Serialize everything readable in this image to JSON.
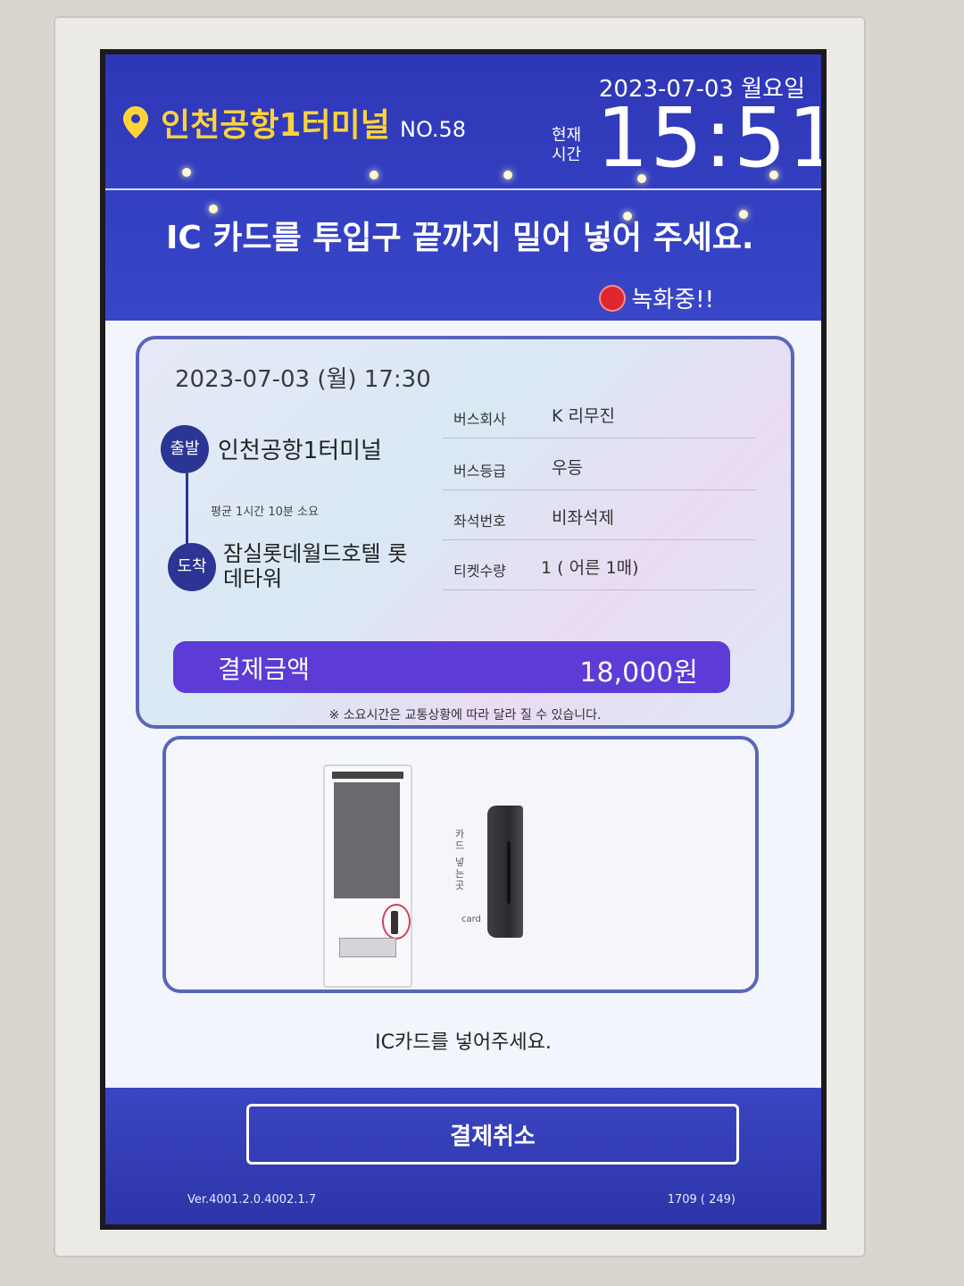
{
  "header": {
    "terminal": "인천공항1터미널",
    "kiosk_no": "NO.58",
    "date": "2023-07-03 월요일",
    "now_label": "현재 시간",
    "time": "15:51",
    "instruction": "IC 카드를 투입구 끝까지 밀어 넣어 주세요.",
    "recording": "녹화중!!"
  },
  "trip": {
    "departure_datetime": "2023-07-03 (월) 17:30",
    "from_badge": "출발",
    "from": "인천공항1터미널",
    "duration": "평균 1시간 10분 소요",
    "to_badge": "도착",
    "to": "잠실롯데월드호텔 롯데타워",
    "details": [
      {
        "label": "버스회사",
        "value": "K 리무진"
      },
      {
        "label": "버스등급",
        "value": "우등"
      },
      {
        "label": "좌석번호",
        "value": "비좌석제"
      },
      {
        "label": "티켓수량",
        "value": "1 ( 어른 1매)"
      }
    ],
    "pay_label": "결제금액",
    "pay_amount": "18,000원",
    "note": "※ 소요시간은 교통상황에 따라 달라 질 수 있습니다."
  },
  "illustration": {
    "reader_label": "카드 넣는곳",
    "reader_card": "card"
  },
  "insert_prompt": "IC카드를 넣어주세요.",
  "footer": {
    "cancel_label": "결제취소",
    "version": "Ver.4001.2.0.4002.1.7",
    "counter": "1709 ( 249)"
  },
  "colors": {
    "header_blue": "#2e37b6",
    "terminal_yellow": "#ffd23a",
    "pay_purple": "#5c3bd6",
    "badge_navy": "#2b3593",
    "record_red": "#e0262e"
  }
}
